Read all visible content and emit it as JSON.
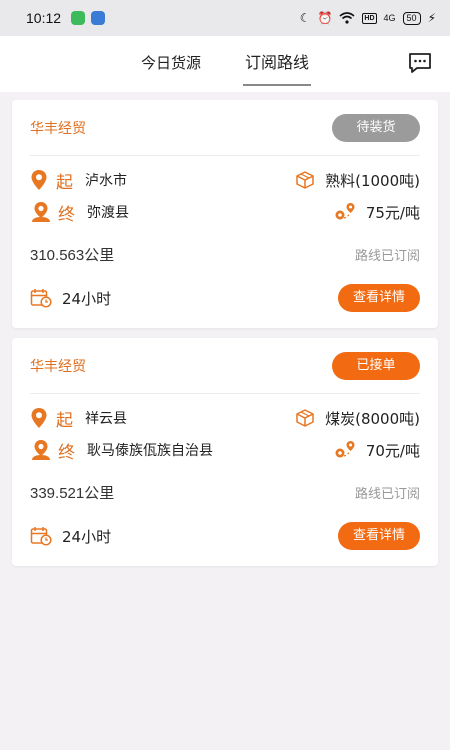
{
  "status_bar": {
    "time": "10:12",
    "battery": "50",
    "signal": "4G",
    "hd": "HD"
  },
  "tabs": [
    {
      "label": "今日货源",
      "active": false
    },
    {
      "label": "订阅路线",
      "active": true
    }
  ],
  "colors": {
    "accent": "#f26a12",
    "company": "#e07020",
    "badge_gray": "#9b9b9b",
    "background": "#f3f1f4"
  },
  "cards": [
    {
      "company": "华丰经贸",
      "status": "待装货",
      "origin_tag": "起",
      "origin": "泸水市",
      "dest_tag": "终",
      "destination": "弥渡县",
      "cargo": "熟料(1000吨)",
      "price": "75元/吨",
      "distance_num": "310.563",
      "distance_unit": "公里",
      "subscription": "路线已订阅",
      "duration": "24小时",
      "detail_label": "查看详情"
    },
    {
      "company": "华丰经贸",
      "status": "已接单",
      "origin_tag": "起",
      "origin": "祥云县",
      "dest_tag": "终",
      "destination": "耿马傣族佤族自治县",
      "cargo": "煤炭(8000吨)",
      "price": "70元/吨",
      "distance_num": "339.521",
      "distance_unit": "公里",
      "subscription": "路线已订阅",
      "duration": "24小时",
      "detail_label": "查看详情"
    }
  ]
}
